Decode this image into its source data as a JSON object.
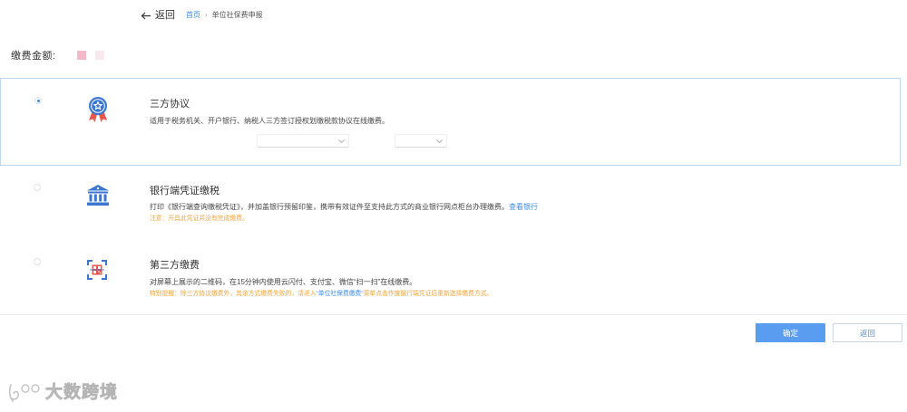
{
  "header": {
    "back_label": "返回",
    "breadcrumb": {
      "home": "首页",
      "separator": "›",
      "current": "单位社保费申报"
    }
  },
  "amount": {
    "label": "缴费金额:"
  },
  "options": [
    {
      "title": "三方协议",
      "desc": "适用于税务机关、开户银行、纳税人三方签订授权划缴税款协议在线缴费。",
      "selected": true,
      "icon": "award-badge-icon"
    },
    {
      "title": "银行端凭证缴税",
      "desc": "打印《银行端查询缴税凭证》，并加盖银行预留印鉴，携带有效证件至支持此方式的商业银行网点柜台办理缴费。",
      "link": "查看银行",
      "note": "注意：开具此凭证并没有完成缴费。",
      "selected": false,
      "icon": "bank-icon"
    },
    {
      "title": "第三方缴费",
      "desc": "对屏幕上展示的二维码，在15分钟内使用云闪付、支付宝、微信“扫一扫”在线缴费。",
      "note_prefix": "特别提醒：除三方协议缴费外，其余方式缴费失败的，请进入",
      "note_link": "“单位社保费缴费”",
      "note_suffix": "菜单点击作废银行端凭证后重新选择缴费方式。",
      "selected": false,
      "icon": "qr-scan-icon"
    }
  ],
  "actions": {
    "confirm": "确定",
    "back": "返回"
  },
  "watermark": "大数跨境",
  "colors": {
    "accent": "#3d8be8",
    "primary_button": "#5a9cf0",
    "note": "#f0a43a",
    "selected_border": "#bcd6f0"
  }
}
